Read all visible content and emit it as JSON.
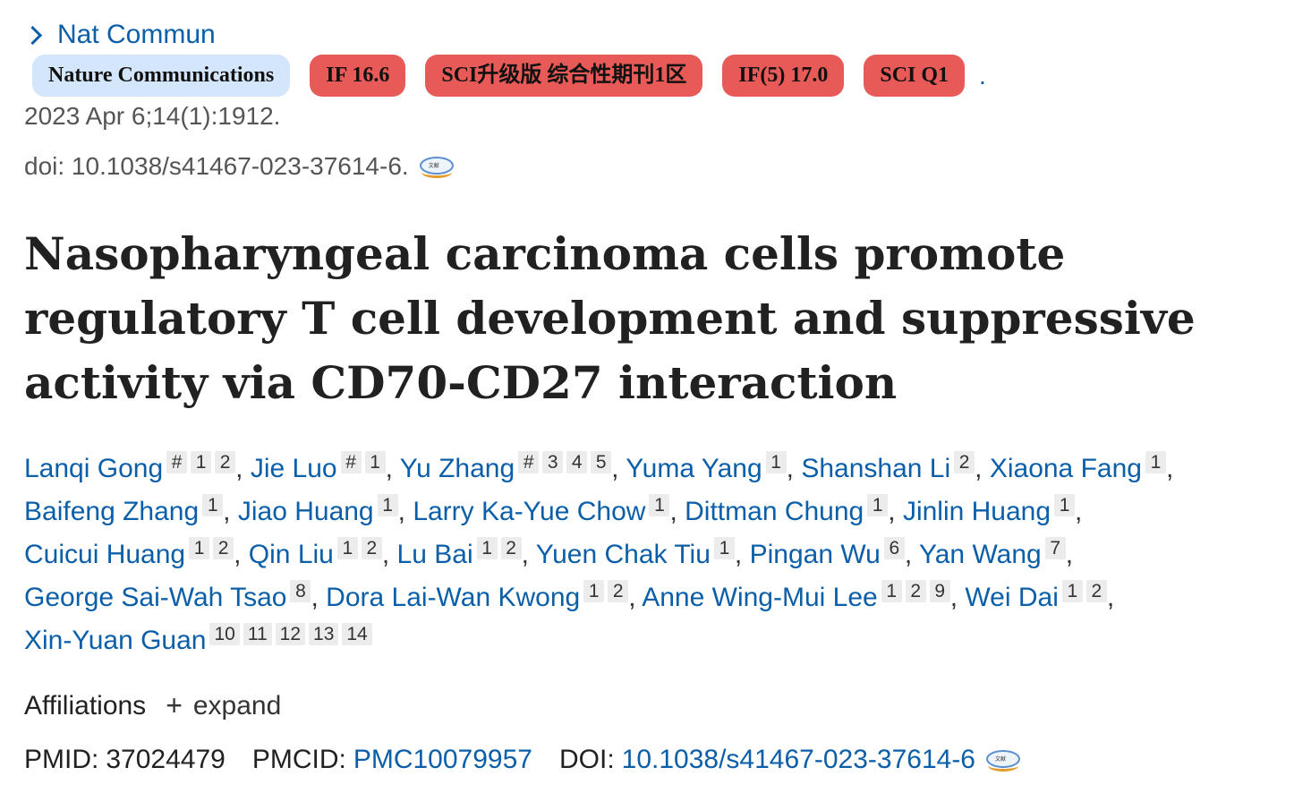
{
  "journal": {
    "link_label": "Nat Commun"
  },
  "badges": [
    {
      "label": "Nature Communications",
      "color": "#d4e6fb"
    },
    {
      "label": "IF 16.6",
      "color": "#e85a57"
    },
    {
      "label": "SCI升级版 综合性期刊1区",
      "color": "#e85a57"
    },
    {
      "label": "IF(5) 17.0",
      "color": "#e85a57"
    },
    {
      "label": "SCI Q1",
      "color": "#e85a57"
    }
  ],
  "badge_trailing": ".",
  "citation": "2023 Apr 6;14(1):1912.",
  "doi_line": "doi: 10.1038/s41467-023-37614-6.",
  "title": "Nasopharyngeal carcinoma cells promote regulatory T cell development and suppressive activity via CD70-CD27 interaction",
  "authors": [
    {
      "name": "Lanqi Gong",
      "marks": [
        "#",
        "1",
        "2"
      ]
    },
    {
      "name": "Jie Luo",
      "marks": [
        "#",
        "1"
      ]
    },
    {
      "name": "Yu Zhang",
      "marks": [
        "#",
        "3",
        "4",
        "5"
      ]
    },
    {
      "name": "Yuma Yang",
      "marks": [
        "1"
      ]
    },
    {
      "name": "Shanshan Li",
      "marks": [
        "2"
      ]
    },
    {
      "name": "Xiaona Fang",
      "marks": [
        "1"
      ]
    },
    {
      "name": "Baifeng Zhang",
      "marks": [
        "1"
      ]
    },
    {
      "name": "Jiao Huang",
      "marks": [
        "1"
      ]
    },
    {
      "name": "Larry Ka-Yue Chow",
      "marks": [
        "1"
      ]
    },
    {
      "name": "Dittman Chung",
      "marks": [
        "1"
      ]
    },
    {
      "name": "Jinlin Huang",
      "marks": [
        "1"
      ]
    },
    {
      "name": "Cuicui Huang",
      "marks": [
        "1",
        "2"
      ]
    },
    {
      "name": "Qin Liu",
      "marks": [
        "1",
        "2"
      ]
    },
    {
      "name": "Lu Bai",
      "marks": [
        "1",
        "2"
      ]
    },
    {
      "name": "Yuen Chak Tiu",
      "marks": [
        "1"
      ]
    },
    {
      "name": "Pingan Wu",
      "marks": [
        "6"
      ]
    },
    {
      "name": "Yan Wang",
      "marks": [
        "7"
      ]
    },
    {
      "name": "George Sai-Wah Tsao",
      "marks": [
        "8"
      ]
    },
    {
      "name": "Dora Lai-Wan Kwong",
      "marks": [
        "1",
        "2"
      ]
    },
    {
      "name": "Anne Wing-Mui Lee",
      "marks": [
        "1",
        "2",
        "9"
      ]
    },
    {
      "name": "Wei Dai",
      "marks": [
        "1",
        "2"
      ]
    },
    {
      "name": "Xin-Yuan Guan",
      "marks": [
        "10",
        "11",
        "12",
        "13",
        "14"
      ]
    }
  ],
  "affiliations": {
    "label": "Affiliations",
    "expand_label": "expand",
    "expand_icon": "plus-icon"
  },
  "identifiers": {
    "pmid_label": "PMID:",
    "pmid": "37024479",
    "pmcid_label": "PMCID:",
    "pmcid": "PMC10079957",
    "doi_label": "DOI:",
    "doi": "10.1038/s41467-023-37614-6"
  },
  "icons": {
    "doi_logo": "library-logo-icon",
    "journal_chevron": "chevron-right-icon"
  },
  "colors": {
    "link": "#0b5ea8",
    "badge_blue": "#d4e6fb",
    "badge_red": "#e85a57"
  }
}
